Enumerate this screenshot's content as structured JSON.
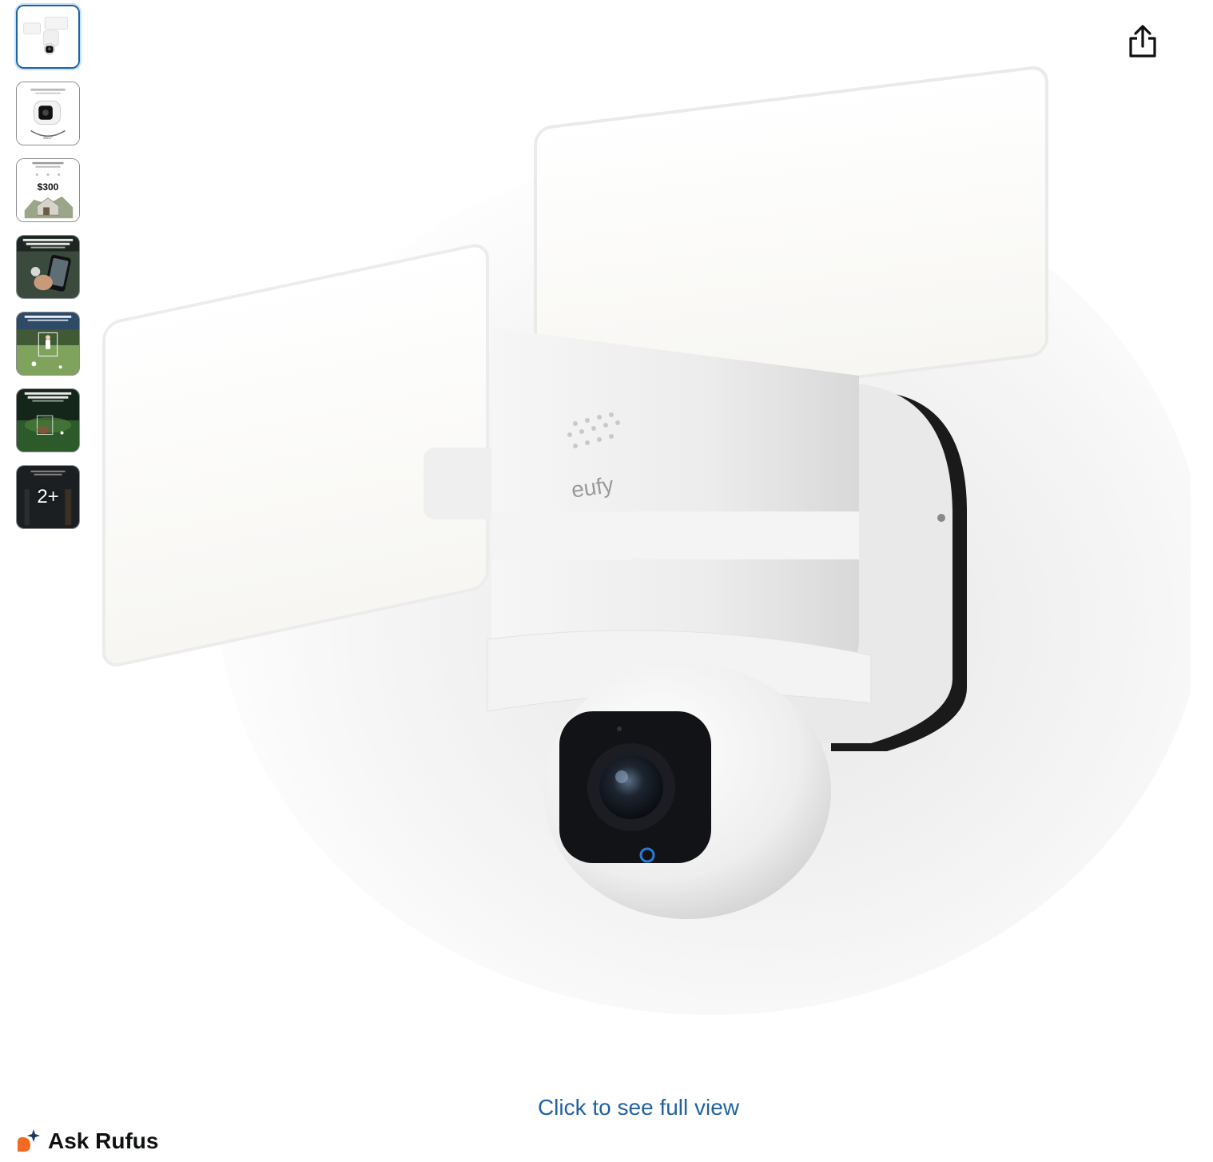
{
  "gallery": {
    "thumbnails": [
      {
        "name": "product-front",
        "selected": true
      },
      {
        "name": "pan-tilt-360",
        "text": ""
      },
      {
        "name": "storage-savings",
        "text": "$300"
      },
      {
        "name": "app-control",
        "text": ""
      },
      {
        "name": "ai-tracking-yard",
        "text": ""
      },
      {
        "name": "night-color",
        "text": ""
      },
      {
        "name": "more-images",
        "more_label": "2+"
      }
    ],
    "brand_mark": "eufy"
  },
  "share": {
    "icon": "share-icon"
  },
  "full_view_link": "Click to see full view",
  "rufus": {
    "label": "Ask Rufus",
    "icon": "rufus-sparkle-icon",
    "colors": {
      "orange": "#f26a21",
      "navy": "#1b3a5c"
    }
  },
  "colors": {
    "link": "#2162a1",
    "selected_border": "#2162a1"
  }
}
